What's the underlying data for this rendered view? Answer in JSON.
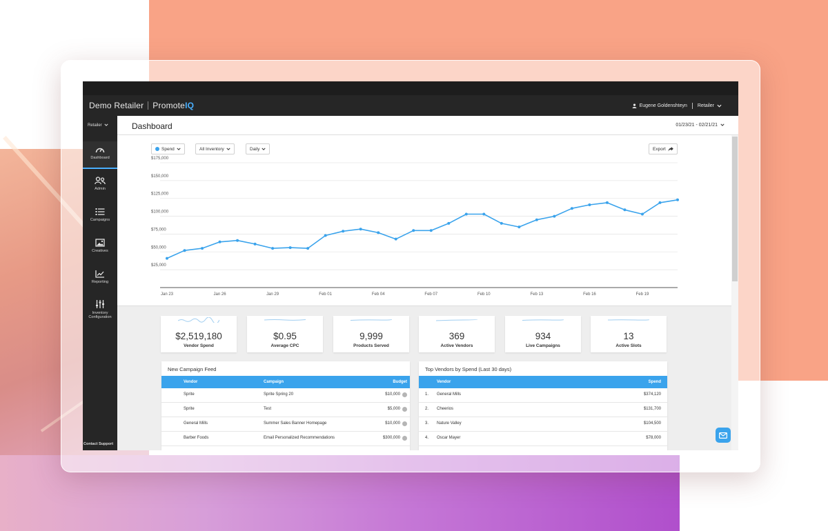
{
  "app": {
    "client": "Demo Retailer",
    "brand_main": "Promote",
    "brand_accent": "IQ",
    "user_name": "Eugene Goldenshteyn",
    "role": "Retailer",
    "accent_color": "#3aa3ec"
  },
  "sidebar": {
    "role_selector": "Retailer",
    "items": [
      {
        "label": "Dashboard",
        "icon": "gauge-icon",
        "active": true
      },
      {
        "label": "Admin",
        "icon": "users-icon",
        "active": false
      },
      {
        "label": "Campaigns",
        "icon": "list-icon",
        "active": false
      },
      {
        "label": "Creatives",
        "icon": "image-icon",
        "active": false
      },
      {
        "label": "Reporting",
        "icon": "chart-icon",
        "active": false
      },
      {
        "label": "Inventory Configuration",
        "icon": "sliders-icon",
        "active": false
      }
    ],
    "contact": "Contact Support"
  },
  "header": {
    "title": "Dashboard",
    "date_range": "01/23/21 - 02/21/21"
  },
  "filters": {
    "metric": "Spend",
    "inventory": "All Inventory",
    "interval": "Daily",
    "export": "Export"
  },
  "chart_data": {
    "type": "line",
    "ylim": [
      0,
      175000
    ],
    "yticks": [
      25000,
      50000,
      75000,
      100000,
      125000,
      150000,
      175000
    ],
    "ytick_labels": [
      "$25,000",
      "$50,000",
      "$75,000",
      "$100,000",
      "$125,000",
      "$150,000",
      "$175,000"
    ],
    "xtick_labels": [
      "Jan 23",
      "Jan 26",
      "Jan 29",
      "Feb 01",
      "Feb 04",
      "Feb 07",
      "Feb 10",
      "Feb 13",
      "Feb 16",
      "Feb 19"
    ],
    "x": [
      "Jan 23",
      "Jan 24",
      "Jan 25",
      "Jan 26",
      "Jan 27",
      "Jan 28",
      "Jan 29",
      "Jan 30",
      "Jan 31",
      "Feb 01",
      "Feb 02",
      "Feb 03",
      "Feb 04",
      "Feb 05",
      "Feb 06",
      "Feb 07",
      "Feb 08",
      "Feb 09",
      "Feb 10",
      "Feb 11",
      "Feb 12",
      "Feb 13",
      "Feb 14",
      "Feb 15",
      "Feb 16",
      "Feb 17",
      "Feb 18",
      "Feb 19",
      "Feb 20",
      "Feb 21"
    ],
    "series": [
      {
        "values": [
          41000,
          52000,
          55000,
          64000,
          66000,
          61000,
          55000,
          56000,
          55000,
          73000,
          79000,
          82000,
          77000,
          68000,
          80000,
          80000,
          90000,
          103000,
          103000,
          90000,
          85000,
          95000,
          100000,
          111000,
          116000,
          119000,
          109000,
          103000,
          119000,
          123000
        ]
      }
    ],
    "grid": true,
    "legend": "none",
    "line_color": "#3aa3ec"
  },
  "kpis": [
    {
      "value": "$2,519,180",
      "label": "Vendor Spend"
    },
    {
      "value": "$0.95",
      "label": "Average CPC"
    },
    {
      "value": "9,999",
      "label": "Products Served"
    },
    {
      "value": "369",
      "label": "Active Vendors"
    },
    {
      "value": "934",
      "label": "Live Campaigns"
    },
    {
      "value": "13",
      "label": "Active Slots"
    }
  ],
  "campaign_feed": {
    "title": "New Campaign Feed",
    "columns": [
      "Vendor",
      "Campaign",
      "Budget"
    ],
    "rows": [
      {
        "vendor": "Sprite",
        "campaign": "Sprite Spring 20",
        "budget": "$10,000"
      },
      {
        "vendor": "Sprite",
        "campaign": "Test",
        "budget": "$5,000"
      },
      {
        "vendor": "General Mills",
        "campaign": "Summer Sales Banner Homepage",
        "budget": "$10,000"
      },
      {
        "vendor": "Barber Foods",
        "campaign": "Email Personalized Recommendations",
        "budget": "$300,000"
      }
    ]
  },
  "top_vendors": {
    "title": "Top Vendors by Spend (Last 30 days)",
    "columns": [
      "Vendor",
      "Spend"
    ],
    "rows": [
      {
        "rank": "1.",
        "vendor": "General Mills",
        "spend": "$374,120"
      },
      {
        "rank": "2.",
        "vendor": "Cheerios",
        "spend": "$131,700"
      },
      {
        "rank": "3.",
        "vendor": "Nature Valley",
        "spend": "$104,500"
      },
      {
        "rank": "4.",
        "vendor": "Oscar Mayer",
        "spend": "$78,000"
      }
    ]
  }
}
